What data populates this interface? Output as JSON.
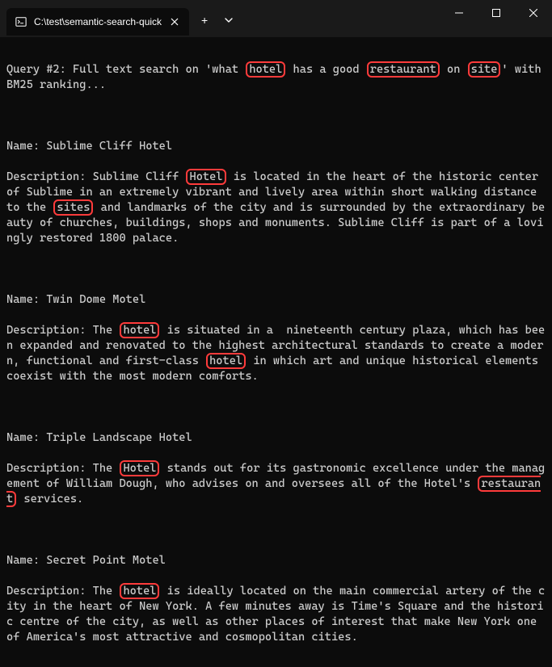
{
  "window": {
    "tab_title": "C:\\test\\semantic-search-quick",
    "tab_icon": "terminal-icon"
  },
  "terminal": {
    "query_prefix": "Query #2: Full text search on 'what ",
    "query_hl1": "hotel",
    "query_mid1": " has a good ",
    "query_hl2": "restaurant",
    "query_mid2": " on ",
    "query_hl3": "site",
    "query_suffix": "' with BM25 ranking...",
    "r1_name": "Name: Sublime Cliff Hotel",
    "r1_d_a": "Description: Sublime Cliff ",
    "r1_d_hl1": "Hotel",
    "r1_d_b": " is located in the heart of the historic center of Sublime in an extremely vibrant and lively area within short walking distance to the ",
    "r1_d_hl2": "sites",
    "r1_d_c": " and landmarks of the city and is surrounded by the extraordinary beauty of churches, buildings, shops and monuments. Sublime Cliff is part of a lovingly restored 1800 palace.",
    "r2_name": "Name: Twin Dome Motel",
    "r2_d_a": "Description: The ",
    "r2_d_hl1": "hotel",
    "r2_d_b": " is situated in a  nineteenth century plaza, which has been expanded and renovated to the highest architectural standards to create a modern, functional and first-class ",
    "r2_d_hl2": "hotel",
    "r2_d_c": " in which art and unique historical elements coexist with the most modern comforts.",
    "r3_name": "Name: Triple Landscape Hotel",
    "r3_d_a": "Description: The ",
    "r3_d_hl1": "Hotel",
    "r3_d_b": " stands out for its gastronomic excellence under the management of William Dough, who advises on and oversees all of the Hotel's ",
    "r3_d_hl2": "restaurant",
    "r3_d_c": " services.",
    "r4_name": "Name: Secret Point Motel",
    "r4_d_a": "Description: The ",
    "r4_d_hl1": "hotel",
    "r4_d_b": " is ideally located on the main commercial artery of the city in the heart of New York. A few minutes away is Time's Square and the historic centre of the city, as well as other places of interest that make New York one of America's most attractive and cosmopolitan cities."
  }
}
